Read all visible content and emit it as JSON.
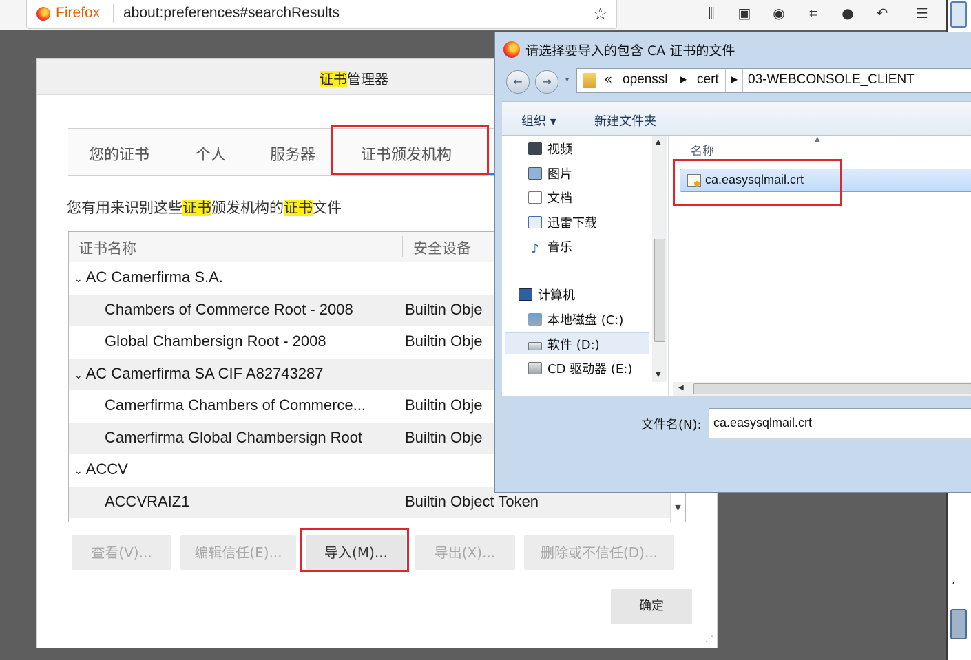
{
  "browser": {
    "brand": "Firefox",
    "url": "about:preferences#searchResults",
    "toolbar_icons": [
      "library-icon",
      "reader-icon",
      "account-icon",
      "screenshot-icon",
      "chat-icon",
      "back-arrow-icon",
      "menu-icon"
    ]
  },
  "cert_manager": {
    "title_highlight": "证书",
    "title_rest": "管理器",
    "tabs": [
      {
        "label": "您的证书"
      },
      {
        "label": "个人"
      },
      {
        "label": "服务器"
      },
      {
        "label": "证书颁发机构",
        "selected": true
      }
    ],
    "desc": {
      "p1": "您有用来识别这些",
      "hl1": "证书",
      "p2": "颁发机构的",
      "hl2": "证书",
      "p3": "文件"
    },
    "columns": [
      "证书名称",
      "安全设备"
    ],
    "rows": [
      {
        "type": "group",
        "name": "AC Camerfirma S.A.",
        "device": ""
      },
      {
        "type": "item",
        "name": "Chambers of Commerce Root - 2008",
        "device": "Builtin Obje"
      },
      {
        "type": "item",
        "name": "Global Chambersign Root - 2008",
        "device": "Builtin Obje"
      },
      {
        "type": "group",
        "name": "AC Camerfirma SA CIF A82743287",
        "device": ""
      },
      {
        "type": "item",
        "name": "Camerfirma Chambers of Commerce...",
        "device": "Builtin Obje"
      },
      {
        "type": "item",
        "name": "Camerfirma Global Chambersign Root",
        "device": "Builtin Obje"
      },
      {
        "type": "group",
        "name": "ACCV",
        "device": ""
      },
      {
        "type": "item",
        "name": "ACCVRAIZ1",
        "device": "Builtin Object Token"
      }
    ],
    "buttons": {
      "view": "查看(V)...",
      "edit_trust": "编辑信任(E)...",
      "import": "导入(M)...",
      "export": "导出(X)...",
      "delete": "删除或不信任(D)..."
    },
    "ok": "确定"
  },
  "file_dialog": {
    "title": "请选择要导入的包含 CA 证书的文件",
    "breadcrumb": {
      "overflow": "«",
      "seg1": "openssl",
      "seg2": "cert",
      "seg3": "03-WEBCONSOLE_CLIENT"
    },
    "toolbar": {
      "organize": "组织 ▾",
      "new_folder": "新建文件夹"
    },
    "nav_items": [
      {
        "label": "视频",
        "icon": "video-icon"
      },
      {
        "label": "图片",
        "icon": "pictures-icon"
      },
      {
        "label": "文档",
        "icon": "documents-icon"
      },
      {
        "label": "迅雷下载",
        "icon": "downloads-icon"
      },
      {
        "label": "音乐",
        "icon": "music-icon"
      },
      {
        "label": "计算机",
        "icon": "computer-icon"
      },
      {
        "label": "本地磁盘 (C:)",
        "icon": "disk-icon"
      },
      {
        "label": "软件 (D:)",
        "icon": "drive-icon"
      },
      {
        "label": "CD 驱动器 (E:)",
        "icon": "cd-drive-icon"
      }
    ],
    "column_name": "名称",
    "file": "ca.easysqlmail.crt",
    "filename_label": "文件名(N):",
    "filename_value": "ca.easysqlmail.crt"
  },
  "colors": {
    "highlight": "#ffef15",
    "annotation_box": "#e0262d",
    "tab_accent": "#0a84ff"
  }
}
